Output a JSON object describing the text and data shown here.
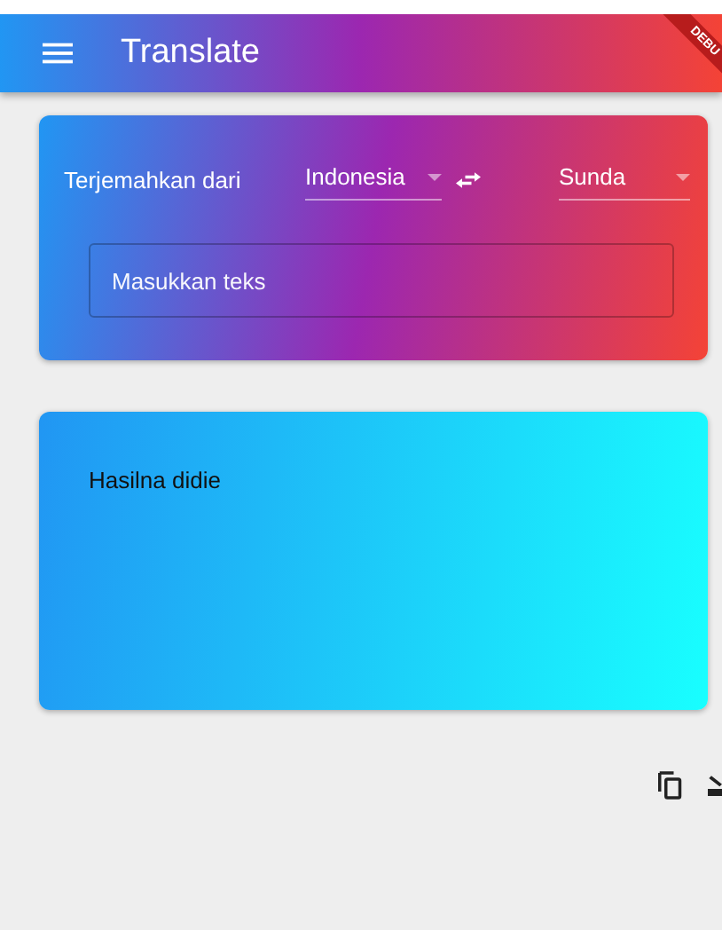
{
  "app_bar": {
    "title": "Translate",
    "debug_banner": "DEBU"
  },
  "translate_card": {
    "from_label": "Terjemahkan dari",
    "source_language": "Indonesia",
    "target_language": "Sunda",
    "input": {
      "placeholder": "Masukkan teks"
    }
  },
  "result_card": {
    "text": "Hasilna didie"
  }
}
